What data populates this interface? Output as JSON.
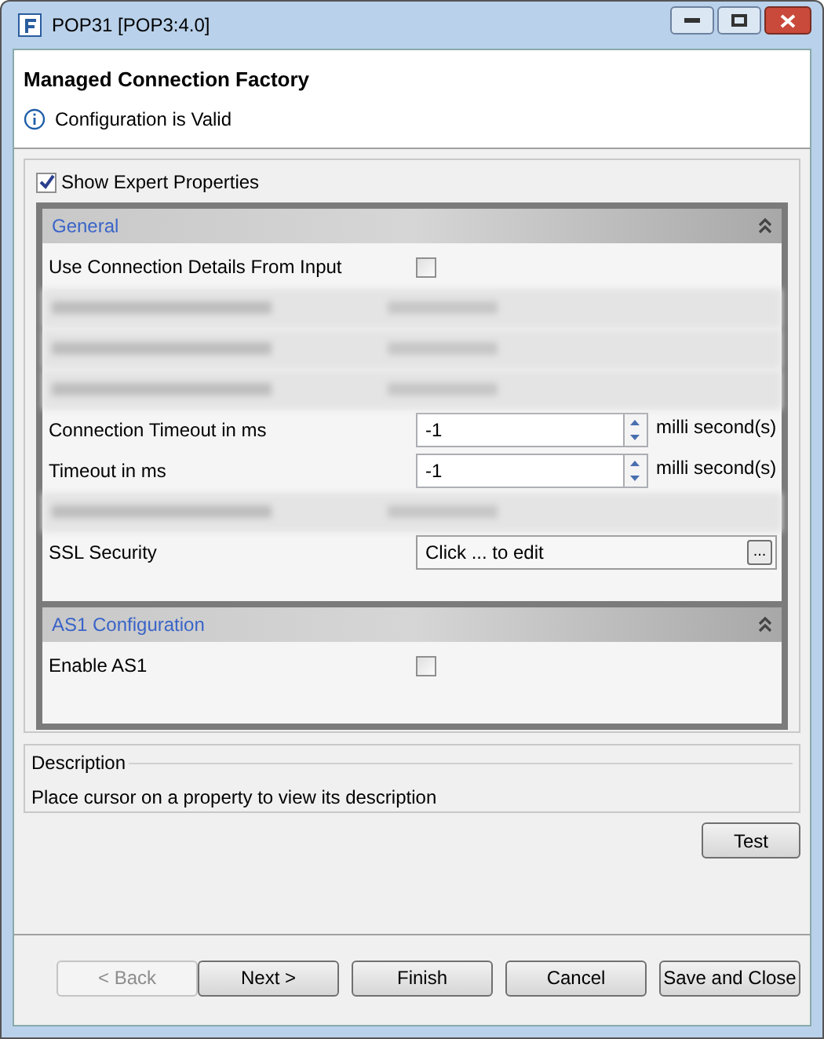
{
  "window": {
    "title": "POP31 [POP3:4.0]"
  },
  "header": {
    "title": "Managed Connection Factory",
    "status": "Configuration is Valid"
  },
  "show_expert": {
    "label": "Show Expert Properties",
    "checked": true
  },
  "sections": [
    {
      "title": "General",
      "expanded": true,
      "rows": [
        {
          "kind": "checkbox",
          "label": "Use Connection Details From Input",
          "checked": false
        },
        {
          "kind": "blurred"
        },
        {
          "kind": "blurred"
        },
        {
          "kind": "blurred"
        },
        {
          "kind": "spinner",
          "label": "Connection Timeout in ms",
          "value": "-1",
          "unit": "milli second(s)"
        },
        {
          "kind": "spinner",
          "label": "Timeout in ms",
          "value": "-1",
          "unit": "milli second(s)"
        },
        {
          "kind": "blurred"
        },
        {
          "kind": "editor",
          "label": "SSL Security",
          "value": "Click ... to edit",
          "button": "..."
        }
      ]
    },
    {
      "title": "AS1 Configuration",
      "expanded": true,
      "rows": [
        {
          "kind": "checkbox",
          "label": "Enable AS1",
          "checked": false
        }
      ]
    }
  ],
  "description": {
    "title": "Description",
    "text": "Place cursor on a property to view its description"
  },
  "test_button": "Test",
  "buttons": [
    {
      "label": "< Back",
      "disabled": true
    },
    {
      "label": "Next >",
      "disabled": false
    },
    {
      "label": "Finish",
      "disabled": false
    },
    {
      "label": "Cancel",
      "disabled": false
    },
    {
      "label": "Save and Close",
      "disabled": false
    }
  ]
}
